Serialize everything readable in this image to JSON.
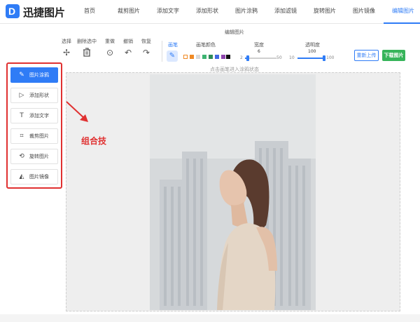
{
  "app": {
    "logo_glyph": "D",
    "brand": "迅捷图片"
  },
  "nav": [
    {
      "label": "首页"
    },
    {
      "label": "裁剪图片"
    },
    {
      "label": "添加文字"
    },
    {
      "label": "添加形状"
    },
    {
      "label": "图片涂鸦"
    },
    {
      "label": "添加滤镜"
    },
    {
      "label": "旋转图片"
    },
    {
      "label": "图片镜像"
    },
    {
      "label": "编辑图片"
    }
  ],
  "toolbar": {
    "title": "编辑图片",
    "tools": [
      {
        "label": "选择",
        "icon": "move-icon",
        "glyph": "✢"
      },
      {
        "label": "删除选中",
        "icon": "trash-icon",
        "glyph": "🗑"
      },
      {
        "label": "重做",
        "icon": "target-icon",
        "glyph": "⊙"
      },
      {
        "label": "撤销",
        "icon": "undo-icon",
        "glyph": "↶"
      },
      {
        "label": "恢复",
        "icon": "redo-icon",
        "glyph": "↷"
      }
    ],
    "brush": {
      "label": "画笔",
      "glyph": "✎"
    },
    "brush_color_label": "画笔颜色",
    "swatches": [
      "#ffffff",
      "#f08a24",
      "#d9d9d9",
      "#3cb371",
      "#2e8b57",
      "#4169e1",
      "#8e44ad"
    ],
    "selected_color": "#111111",
    "width": {
      "label": "宽度",
      "value": "6",
      "min": "2",
      "max": "50",
      "level": 0.083
    },
    "opacity": {
      "label": "透明度",
      "value": "100",
      "min": "10",
      "max": "100",
      "level": 1.0
    },
    "reupload": "重新上传",
    "download": "下载图片"
  },
  "sidebar": {
    "items": [
      {
        "label": "图片涂鸦",
        "icon": "brush-icon",
        "glyph": "✎"
      },
      {
        "label": "添加形状",
        "icon": "shape-icon",
        "glyph": "▷"
      },
      {
        "label": "添加文字",
        "icon": "text-icon",
        "glyph": "T"
      },
      {
        "label": "裁剪图片",
        "icon": "crop-icon",
        "glyph": "⌗"
      },
      {
        "label": "旋转图片",
        "icon": "rotate-icon",
        "glyph": "⟲"
      },
      {
        "label": "图片镜像",
        "icon": "mirror-icon",
        "glyph": "◭"
      }
    ]
  },
  "annotation": {
    "text": "组合技"
  },
  "canvas": {
    "hint": "点击画笔进入涂鸦状态"
  },
  "colors": {
    "accent": "#2f7cf6",
    "download": "#36b45a",
    "annotation": "#e03131"
  }
}
